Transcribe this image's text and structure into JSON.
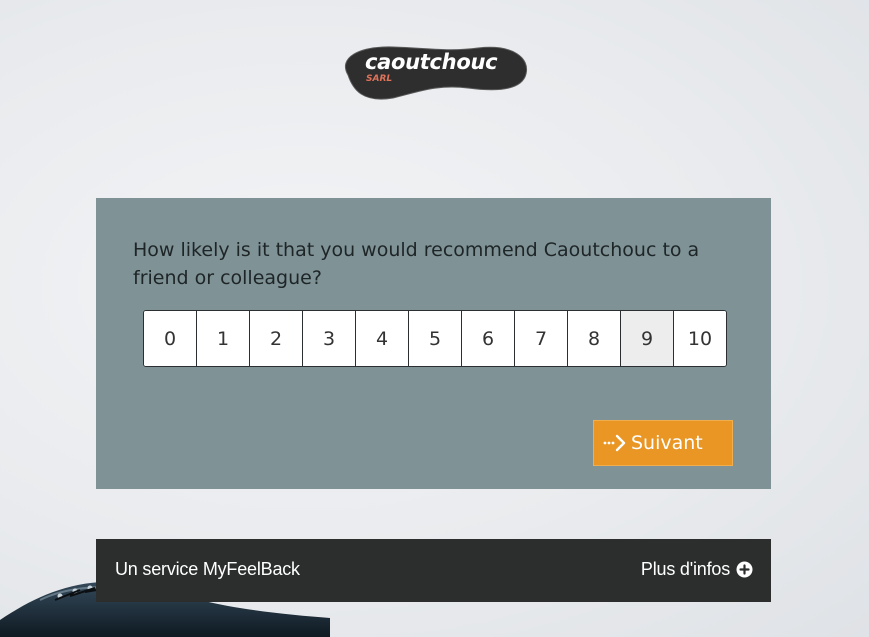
{
  "brand": {
    "logo_text": "caoutchouc",
    "logo_sub": "SARL"
  },
  "survey": {
    "question": "How likely is it that you would recommend Caoutchouc to a friend or colleague?",
    "scale": [
      "0",
      "1",
      "2",
      "3",
      "4",
      "5",
      "6",
      "7",
      "8",
      "9",
      "10"
    ],
    "selected": "9",
    "next_label": "Suivant"
  },
  "footer": {
    "service_label": "Un service MyFeelBack",
    "more_info_label": "Plus d'infos"
  },
  "colors": {
    "card": "#7f9296",
    "button": "#e99624",
    "footer": "#2c2e2e"
  },
  "icons": {
    "next": "dotted-arrow-right-icon",
    "more_info": "plus-circle-icon",
    "decor": "shoe-image"
  }
}
